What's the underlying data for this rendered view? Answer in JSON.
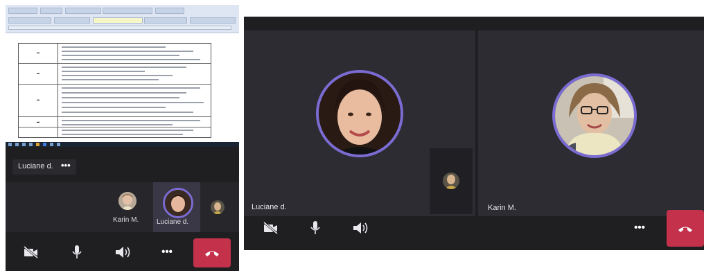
{
  "left_view": {
    "presenter_chip": {
      "name": "Luciane d.",
      "more": "•••"
    },
    "participants": [
      {
        "name": "Karin M."
      },
      {
        "name": "Luciane d."
      }
    ],
    "controls": {
      "camera": "camera-off-icon",
      "mic": "microphone-icon",
      "speaker": "speaker-icon",
      "more": "•••",
      "hangup": "hang-up-icon"
    }
  },
  "right_view": {
    "tiles": [
      {
        "name": "Luciane d."
      },
      {
        "name": "Karin M."
      }
    ],
    "controls": {
      "camera": "camera-off-icon",
      "mic": "microphone-icon",
      "speaker": "speaker-icon",
      "more": "•••",
      "hangup": "hang-up-icon"
    }
  },
  "colors": {
    "background": "#1f1f22",
    "tile": "#2d2c33",
    "avatar_ring": "#7b6cd3",
    "hangup": "#c4314b"
  }
}
